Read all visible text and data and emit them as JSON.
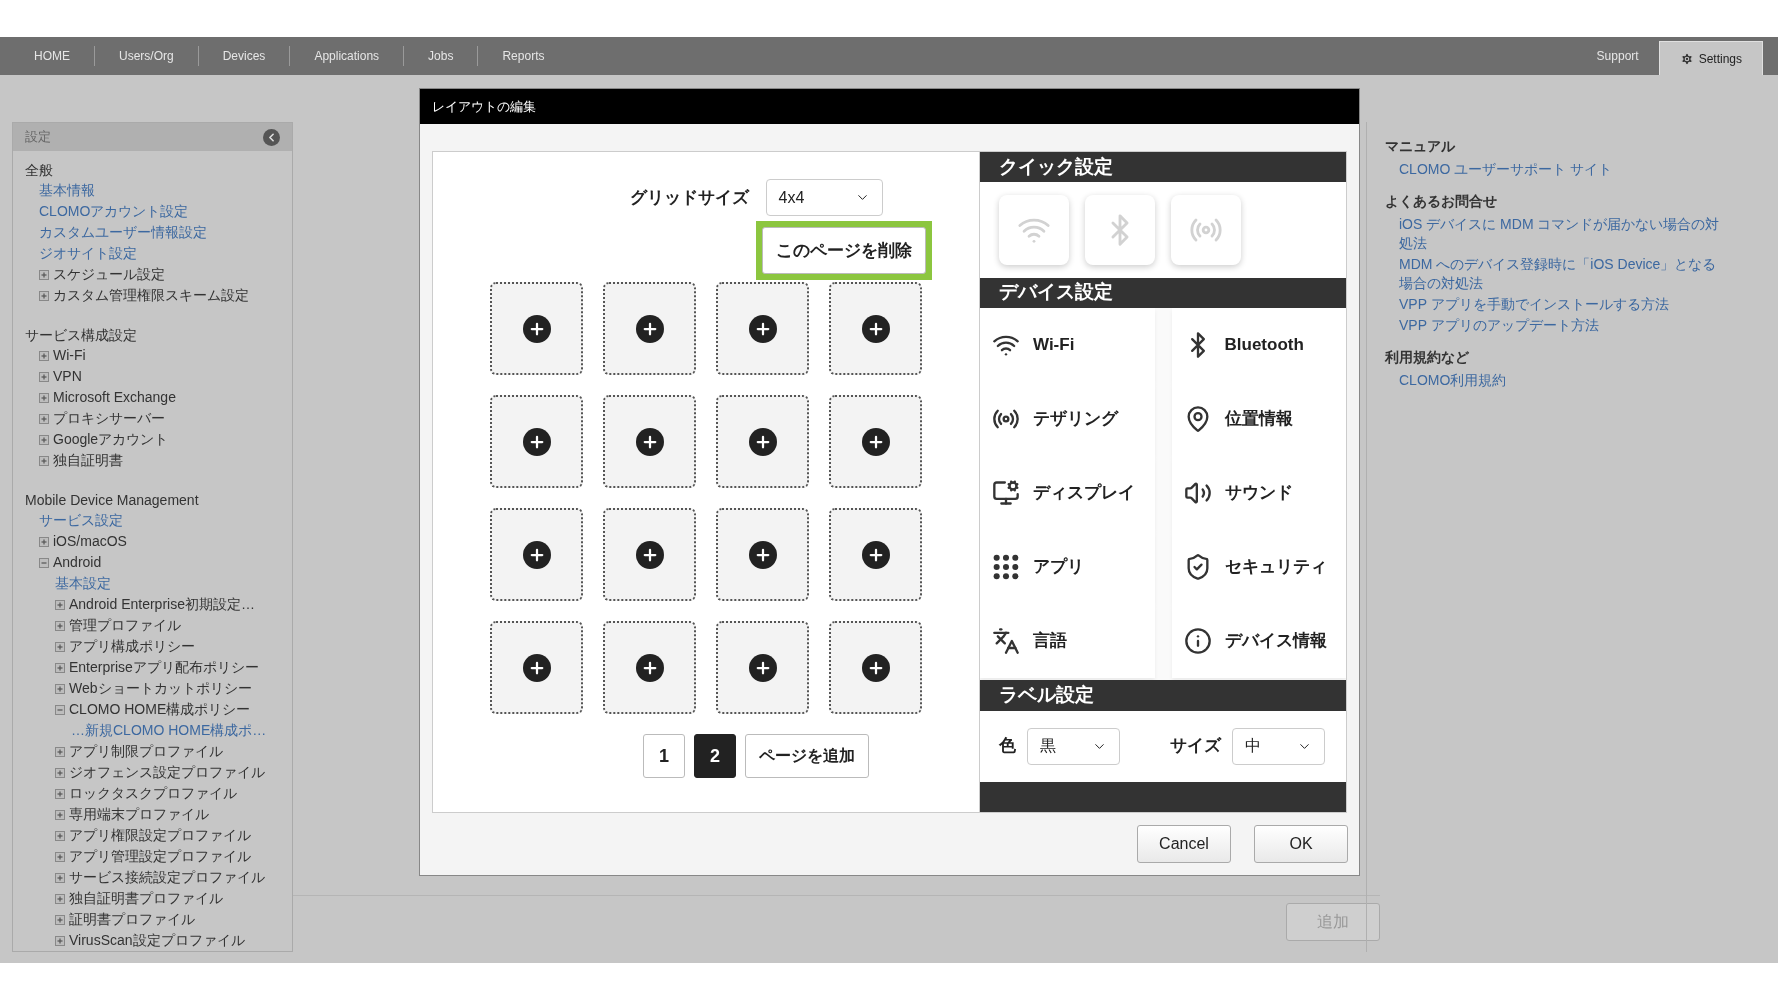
{
  "nav": {
    "left_items": [
      {
        "label": "HOME",
        "selected": false
      },
      {
        "label": "Users/Org",
        "selected": false
      },
      {
        "label": "Devices",
        "selected": false
      },
      {
        "label": "Applications",
        "selected": false
      },
      {
        "label": "Jobs",
        "selected": false
      },
      {
        "label": "Reports",
        "selected": false
      }
    ],
    "right_items": [
      {
        "label": "Support",
        "selected": false,
        "kind": "plain"
      },
      {
        "label": "Settings",
        "selected": true,
        "kind": "gear"
      }
    ]
  },
  "sidebar": {
    "title": "設定",
    "sections": [
      {
        "heading": "全般",
        "items": [
          {
            "kind": "link",
            "label": "基本情報"
          },
          {
            "kind": "link",
            "label": "CLOMOアカウント設定"
          },
          {
            "kind": "link",
            "label": "カスタムユーザー情報設定"
          },
          {
            "kind": "link",
            "label": "ジオサイト設定"
          },
          {
            "kind": "node",
            "label": "スケジュール設定",
            "expanded": false
          },
          {
            "kind": "node",
            "label": "カスタム管理権限スキーム設定",
            "expanded": false
          }
        ]
      },
      {
        "heading": "サービス構成設定",
        "items": [
          {
            "kind": "node",
            "label": "Wi-Fi",
            "expanded": false
          },
          {
            "kind": "node",
            "label": "VPN",
            "expanded": false
          },
          {
            "kind": "node",
            "label": "Microsoft Exchange",
            "expanded": false
          },
          {
            "kind": "node",
            "label": "プロキシサーバー",
            "expanded": false
          },
          {
            "kind": "node",
            "label": "Googleアカウント",
            "expanded": false
          },
          {
            "kind": "node",
            "label": "独自証明書",
            "expanded": false
          }
        ]
      },
      {
        "heading": "Mobile Device Management",
        "items": [
          {
            "kind": "link",
            "label": "サービス設定"
          },
          {
            "kind": "node",
            "label": "iOS/macOS",
            "expanded": false
          },
          {
            "kind": "node",
            "label": "Android",
            "expanded": true,
            "children": [
              {
                "kind": "link",
                "label": "基本設定"
              },
              {
                "kind": "node",
                "label": "Android Enterprise初期設定…",
                "expanded": false
              },
              {
                "kind": "node",
                "label": "管理プロファイル",
                "expanded": false
              },
              {
                "kind": "node",
                "label": "アプリ構成ポリシー",
                "expanded": false
              },
              {
                "kind": "node",
                "label": "Enterpriseアプリ配布ポリシー",
                "expanded": false
              },
              {
                "kind": "node",
                "label": "Webショートカットポリシー",
                "expanded": false
              },
              {
                "kind": "node",
                "label": "CLOMO HOME構成ポリシー",
                "expanded": true,
                "children": [
                  {
                    "kind": "link",
                    "label": "…新規CLOMO HOME構成ポ…"
                  }
                ]
              },
              {
                "kind": "node",
                "label": "アプリ制限プロファイル",
                "expanded": false
              },
              {
                "kind": "node",
                "label": "ジオフェンス設定プロファイル",
                "expanded": false
              },
              {
                "kind": "node",
                "label": "ロックタスクプロファイル",
                "expanded": false
              },
              {
                "kind": "node",
                "label": "専用端末プロファイル",
                "expanded": false
              },
              {
                "kind": "node",
                "label": "アプリ権限設定プロファイル",
                "expanded": false
              },
              {
                "kind": "node",
                "label": "アプリ管理設定プロファイル",
                "expanded": false
              },
              {
                "kind": "node",
                "label": "サービス接続設定プロファイル",
                "expanded": false
              },
              {
                "kind": "node",
                "label": "独自証明書プロファイル",
                "expanded": false
              },
              {
                "kind": "node",
                "label": "証明書プロファイル",
                "expanded": false
              },
              {
                "kind": "node",
                "label": "VirusScan設定プロファイル",
                "expanded": false
              }
            ]
          }
        ]
      }
    ]
  },
  "dialog": {
    "title": "レイアウトの編集",
    "grid_size": {
      "label": "グリッドサイズ",
      "value": "4x4"
    },
    "delete_page_button": {
      "label": "このページを削除",
      "highlighted": true
    },
    "pages": [
      {
        "label": "1",
        "selected": false
      },
      {
        "label": "2",
        "selected": true
      }
    ],
    "add_page_button": "ページを追加",
    "quick_settings": {
      "title": "クイック設定",
      "tiles": [
        {
          "disabled": true
        },
        {
          "disabled": true
        },
        {
          "disabled": true
        }
      ]
    },
    "device_settings": {
      "title": "デバイス設定",
      "tiles": [
        {
          "label": "Wi-Fi"
        },
        {
          "label": "Bluetooth"
        },
        {
          "label": "テザリング"
        },
        {
          "label": "位置情報"
        },
        {
          "label": "ディスプレイ"
        },
        {
          "label": "サウンド"
        },
        {
          "label": "アプリ"
        },
        {
          "label": "セキュリティ"
        },
        {
          "label": "言語"
        },
        {
          "label": "デバイス情報"
        }
      ]
    },
    "label_settings": {
      "title": "ラベル設定",
      "color": {
        "label": "色",
        "value": "黒"
      },
      "size": {
        "label": "サイズ",
        "value": "中"
      }
    },
    "buttons": [
      {
        "label": "Cancel"
      },
      {
        "label": "OK"
      }
    ]
  },
  "add_button": {
    "label": "追加",
    "disabled": true
  },
  "help": {
    "sections": [
      {
        "heading": "マニュアル",
        "links": [
          "CLOMO ユーザーサポート サイト"
        ]
      },
      {
        "heading": "よくあるお問合せ",
        "links": [
          "iOS デバイスに MDM コマンドが届かない場合の対処法",
          "MDM へのデバイス登録時に「iOS Device」となる場合の対処法",
          "VPP アプリを手動でインストールする方法",
          "VPP アプリのアップデート方法"
        ]
      },
      {
        "heading": "利用規約など",
        "links": [
          "CLOMO利用規約"
        ]
      }
    ]
  }
}
